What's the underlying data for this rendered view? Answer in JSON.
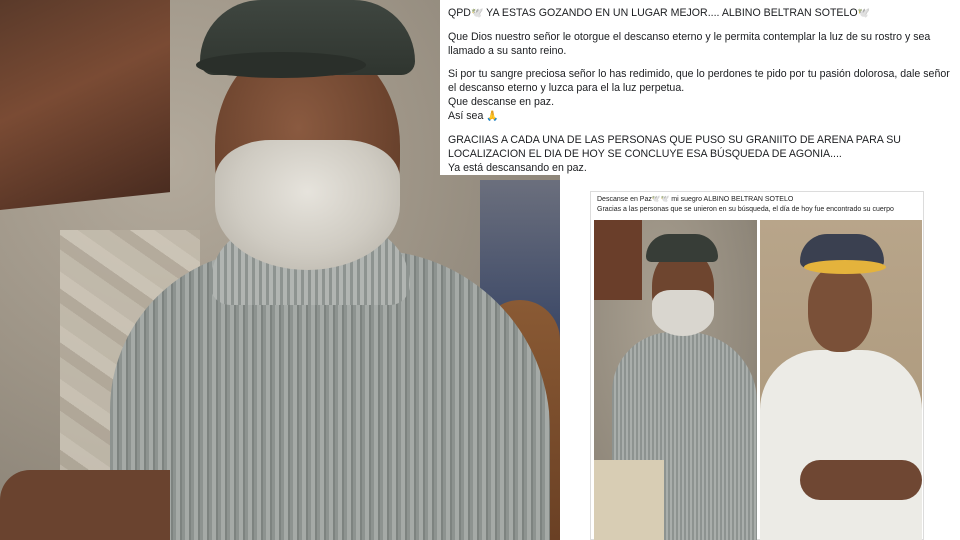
{
  "post": {
    "headline_prefix": "QPD",
    "dove_icon": "dove-icon",
    "headline_main": "  YA ESTAS GOZANDO EN UN LUGAR MEJOR....  ALBINO BELTRAN SOTELO",
    "paragraph_1": "Que Dios nuestro señor le otorgue el descanso eterno y le permita contemplar la luz de su rostro y sea llamado a su santo reino.",
    "paragraph_2_line_1": "Si por tu sangre preciosa señor lo has redimido, que lo perdones te pido por tu pasión dolorosa, dale señor el descanso eterno y luzca para el la luz perpetua.",
    "paragraph_2_line_2": "Que descanse en paz.",
    "paragraph_2_line_3": "Así sea",
    "praying_hands_icon": "praying-hands-icon",
    "paragraph_3": "GRACIIAS A CADA UNA  DE LAS PERSONAS QUE PUSO SU GRANIITO DE ARENA PARA SU LOCALIZACION EL DIA DE HOY SE CONCLUYE ESA BÚSQUEDA DE AGONIA....",
    "paragraph_3_last": " Ya está descansando en paz."
  },
  "card": {
    "line_1_prefix": "Descanse en Paz",
    "line_1_suffix": " mi suegro ALBINO BELTRAN SOTELO",
    "line_2": "Gracias a las personas que se unieron en su búsqueda, el día de hoy fue encontrado su cuerpo"
  }
}
